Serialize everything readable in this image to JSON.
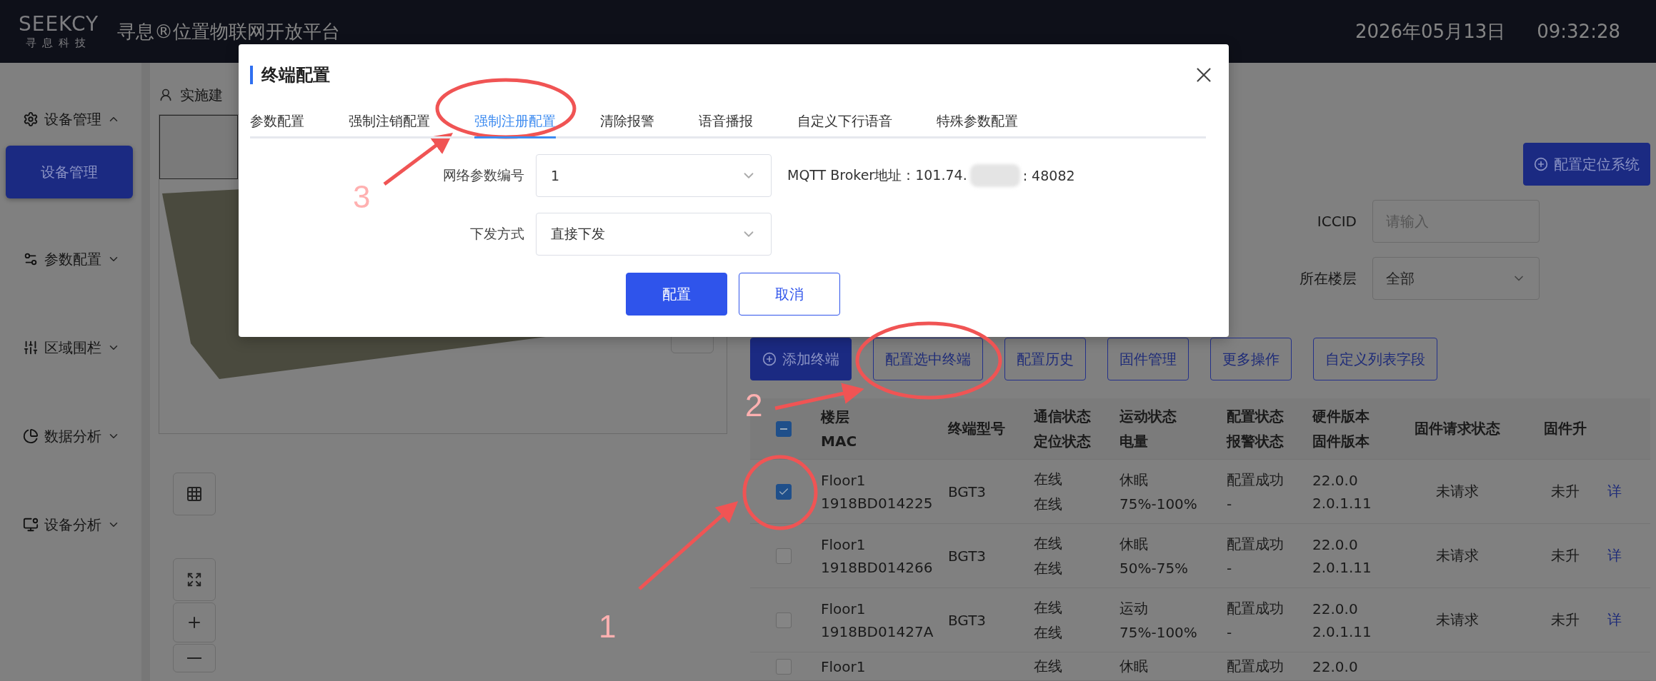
{
  "header": {
    "logo_text": "SEEKCY",
    "logo_subtext": "寻息科技",
    "title": "寻息®位置物联网开放平台",
    "date": "2026年05月13日",
    "time": "09:32:28"
  },
  "sidebar": {
    "items": [
      {
        "label": "设备管理",
        "expanded": true,
        "children": [
          {
            "label": "设备管理",
            "selected": true
          }
        ]
      },
      {
        "label": "参数配置",
        "expanded": false
      },
      {
        "label": "区域围栏",
        "expanded": false
      },
      {
        "label": "数据分析",
        "expanded": false
      },
      {
        "label": "设备分析",
        "expanded": false
      }
    ]
  },
  "breadcrumb": "实施建",
  "right_panel": {
    "locate_button": "配置定位系统",
    "filters": [
      {
        "label": "ICCID",
        "placeholder": "请输入"
      },
      {
        "label": "所在楼层",
        "value": "全部"
      }
    ],
    "toolbar": [
      {
        "label": "添加终端",
        "kind": "primary"
      },
      {
        "label": "配置选中终端",
        "kind": "outline"
      },
      {
        "label": "配置历史",
        "kind": "outline"
      },
      {
        "label": "固件管理",
        "kind": "outline"
      },
      {
        "label": "更多操作",
        "kind": "outline"
      },
      {
        "label": "自定义列表字段",
        "kind": "outline"
      }
    ],
    "table": {
      "header_checkbox": {
        "indeterminate": true
      },
      "columns": [
        {
          "lines": [
            "楼层",
            "MAC"
          ]
        },
        {
          "lines": [
            "终端型号"
          ]
        },
        {
          "lines": [
            "通信状态",
            "定位状态"
          ]
        },
        {
          "lines": [
            "运动状态",
            "电量"
          ]
        },
        {
          "lines": [
            "配置状态",
            "报警状态"
          ]
        },
        {
          "lines": [
            "硬件版本",
            "固件版本"
          ]
        },
        {
          "lines": [
            "固件请求状态"
          ]
        },
        {
          "lines": [
            "固件升"
          ]
        }
      ],
      "rows": [
        {
          "checked": true,
          "cells": [
            {
              "lines": [
                "Floor1",
                "1918BD014225"
              ]
            },
            {
              "lines": [
                "BGT3"
              ]
            },
            {
              "lines": [
                "在线",
                "在线"
              ]
            },
            {
              "lines": [
                "休眠",
                "75%-100%"
              ]
            },
            {
              "lines": [
                "配置成功",
                "-"
              ]
            },
            {
              "lines": [
                "22.0.0",
                "2.0.1.11"
              ]
            },
            {
              "lines": [
                "未请求"
              ]
            },
            {
              "lines": [
                "未升"
              ]
            }
          ],
          "action": "详"
        },
        {
          "checked": false,
          "cells": [
            {
              "lines": [
                "Floor1",
                "1918BD014266"
              ]
            },
            {
              "lines": [
                "BGT3"
              ]
            },
            {
              "lines": [
                "在线",
                "在线"
              ]
            },
            {
              "lines": [
                "休眠",
                "50%-75%"
              ]
            },
            {
              "lines": [
                "配置成功",
                "-"
              ]
            },
            {
              "lines": [
                "22.0.0",
                "2.0.1.11"
              ]
            },
            {
              "lines": [
                "未请求"
              ]
            },
            {
              "lines": [
                "未升"
              ]
            }
          ],
          "action": "详"
        },
        {
          "checked": false,
          "cells": [
            {
              "lines": [
                "Floor1",
                "1918BD01427A"
              ]
            },
            {
              "lines": [
                "BGT3"
              ]
            },
            {
              "lines": [
                "在线",
                "在线"
              ]
            },
            {
              "lines": [
                "运动",
                "75%-100%"
              ]
            },
            {
              "lines": [
                "配置成功",
                "-"
              ]
            },
            {
              "lines": [
                "22.0.0",
                "2.0.1.11"
              ]
            },
            {
              "lines": [
                "未请求"
              ]
            },
            {
              "lines": [
                "未升"
              ]
            }
          ],
          "action": "详"
        },
        {
          "checked": false,
          "cells": [
            {
              "lines": [
                "Floor1"
              ]
            },
            {},
            {
              "lines": [
                "在线"
              ]
            },
            {
              "lines": [
                "休眠"
              ]
            },
            {
              "lines": [
                "配置成功"
              ]
            },
            {
              "lines": [
                "22.0.0"
              ]
            },
            {},
            {}
          ]
        }
      ]
    }
  },
  "dialog": {
    "title": "终端配置",
    "tabs": [
      {
        "label": "参数配置",
        "selected": false
      },
      {
        "label": "强制注销配置",
        "selected": false
      },
      {
        "label": "强制注册配置",
        "selected": true
      },
      {
        "label": "清除报警",
        "selected": false
      },
      {
        "label": "语音播报",
        "selected": false
      },
      {
        "label": "自定义下行语音",
        "selected": false
      },
      {
        "label": "特殊参数配置",
        "selected": false
      }
    ],
    "fields": [
      {
        "label": "网络参数编号",
        "value": "1"
      },
      {
        "label": "下发方式",
        "value": "直接下发"
      }
    ],
    "broker_label": "MQTT Broker地址：101.74.",
    "broker_suffix": ": 48082",
    "buttons": [
      {
        "label": "配置",
        "kind": "primary"
      },
      {
        "label": "取消",
        "kind": "outline"
      }
    ]
  },
  "annotations": [
    {
      "label": "1"
    },
    {
      "label": "2"
    },
    {
      "label": "3"
    }
  ]
}
